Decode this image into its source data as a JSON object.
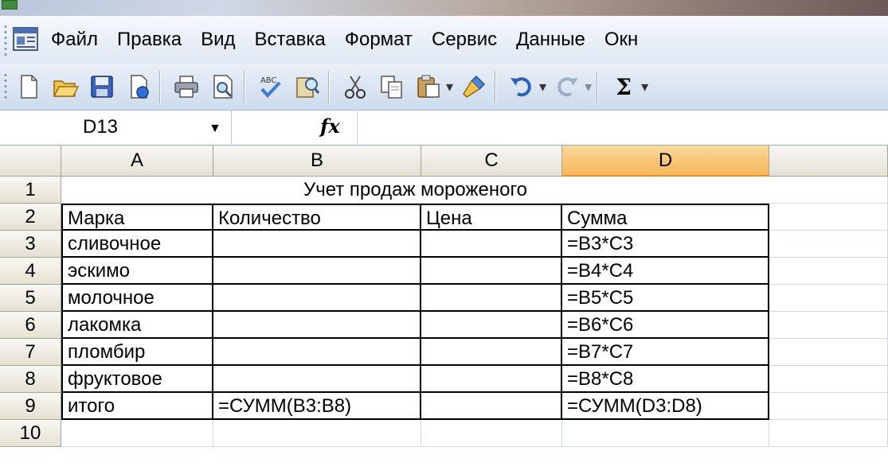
{
  "menu": {
    "items": [
      {
        "label": "Файл"
      },
      {
        "label": "Правка"
      },
      {
        "label": "Вид"
      },
      {
        "label": "Вставка"
      },
      {
        "label": "Формат"
      },
      {
        "label": "Сервис"
      },
      {
        "label": "Данные"
      },
      {
        "label": "Окн"
      }
    ]
  },
  "toolbar": {
    "icons": [
      "new-icon",
      "open-icon",
      "save-icon",
      "permission-icon",
      "print-icon",
      "print-preview-icon",
      "spelling-icon",
      "research-icon",
      "cut-icon",
      "copy-icon",
      "paste-icon",
      "format-painter-icon",
      "undo-icon",
      "redo-icon",
      "autosum-icon"
    ],
    "sigma": "Σ",
    "spelling_text": "ABC"
  },
  "formula_bar": {
    "name_box": "D13",
    "fx": "fx",
    "formula": ""
  },
  "grid": {
    "columns": [
      "A",
      "B",
      "C",
      "D"
    ],
    "selected_column": "D",
    "rows": [
      "1",
      "2",
      "3",
      "4",
      "5",
      "6",
      "7",
      "8",
      "9",
      "10"
    ],
    "title": "Учет продаж мороженого",
    "headers": [
      "Марка",
      "Количество",
      "Цена",
      "Сумма"
    ],
    "data": [
      [
        "сливочное",
        "",
        "",
        "=B3*C3"
      ],
      [
        "эскимо",
        "",
        "",
        "=B4*C4"
      ],
      [
        "молочное",
        "",
        "",
        "=B5*C5"
      ],
      [
        "лакомка",
        "",
        "",
        "=B6*C6"
      ],
      [
        "пломбир",
        "",
        "",
        "=B7*C7"
      ],
      [
        "фруктовое",
        "",
        "",
        "=B8*C8"
      ],
      [
        "итого",
        "=СУММ(B3:B8)",
        "",
        "=СУММ(D3:D8)"
      ]
    ]
  },
  "colors": {
    "selected_header": "#f6b75a",
    "grid_line": "#d0d7e5",
    "toolbar_bg": "#dfe7f3"
  }
}
